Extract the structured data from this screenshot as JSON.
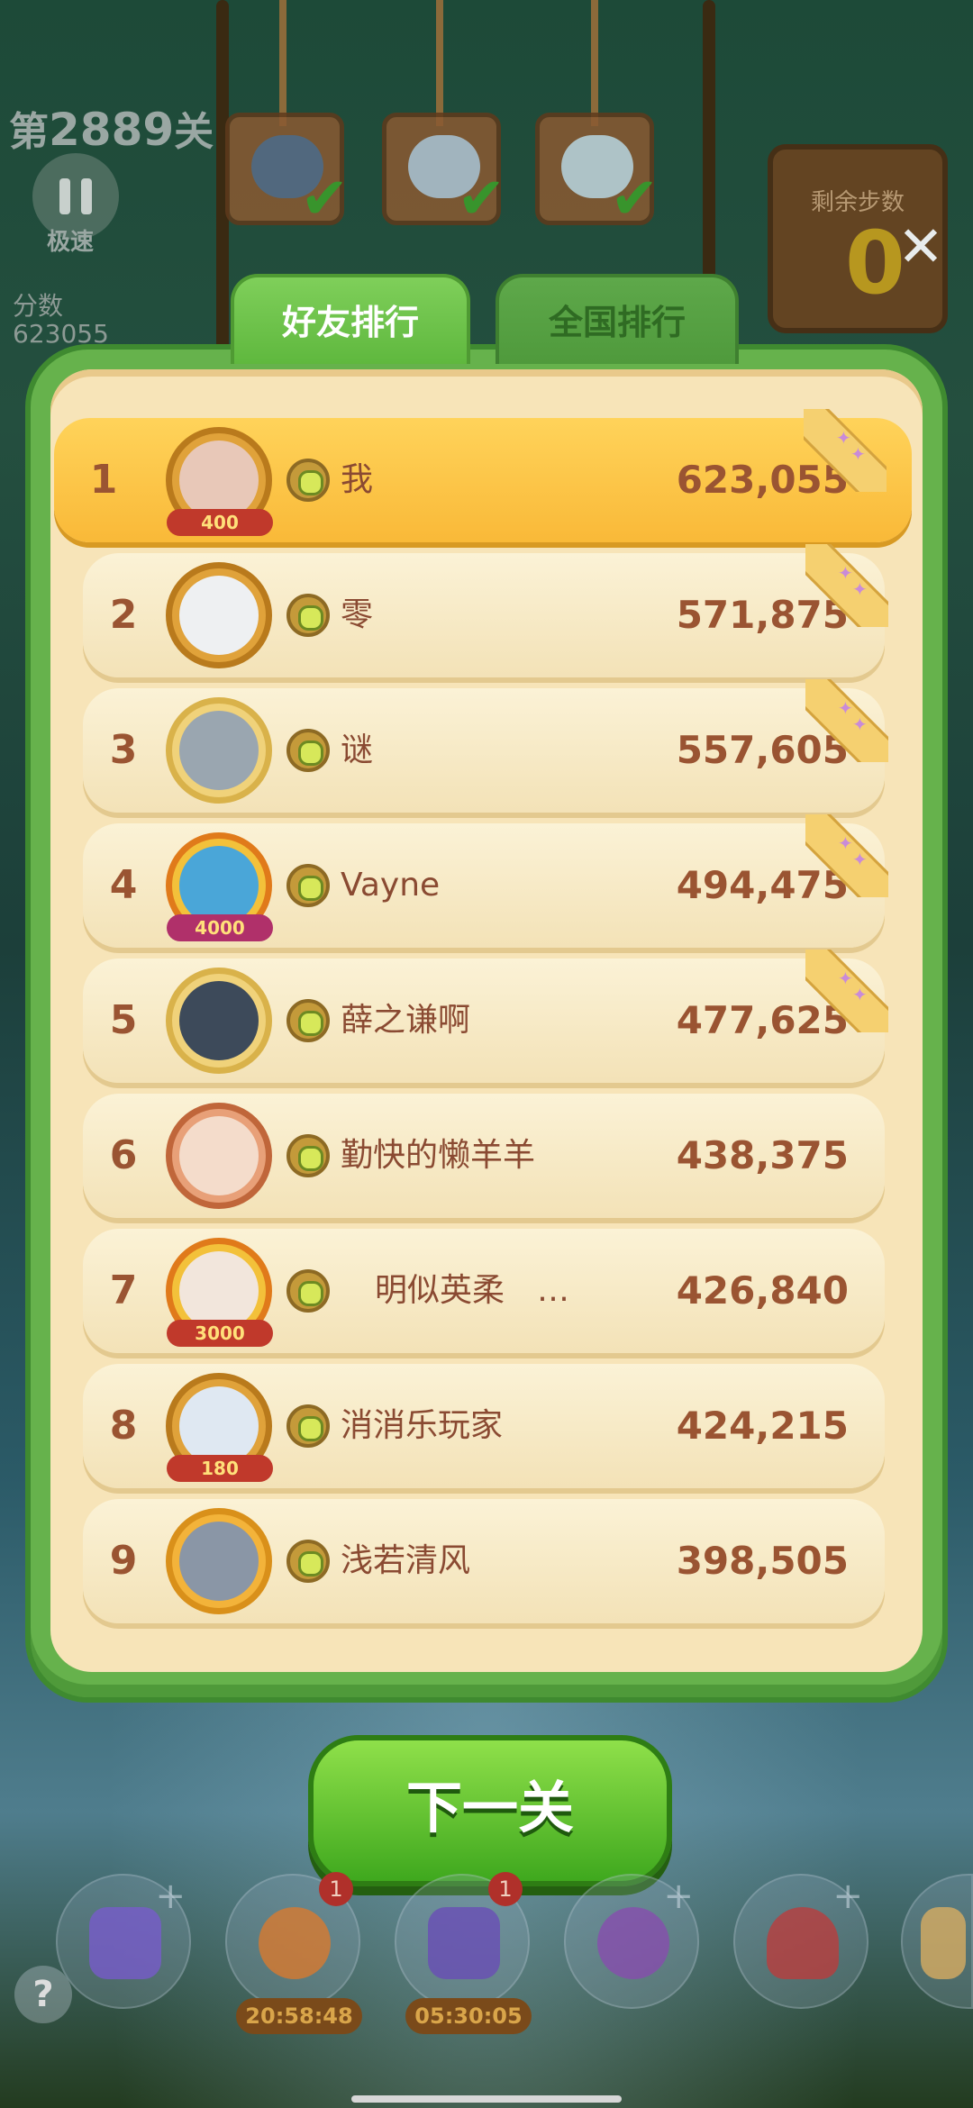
{
  "header": {
    "level_prefix": "第",
    "level_number": "2889",
    "level_suffix": "关",
    "speed_label": "极速",
    "score_label": "分数",
    "score_value": "623055",
    "moves_label": "剩余步数",
    "moves_value": "0"
  },
  "tabs": [
    {
      "label": "好友排行",
      "active": true
    },
    {
      "label": "全国排行",
      "active": false
    }
  ],
  "leaderboard": {
    "rows": [
      {
        "rank": "1",
        "name": "我",
        "score": "623,055",
        "badge": "400"
      },
      {
        "rank": "2",
        "name": "零",
        "score": "571,875",
        "badge": ""
      },
      {
        "rank": "3",
        "name": "谜",
        "score": "557,605",
        "badge": ""
      },
      {
        "rank": "4",
        "name": "Vayne",
        "score": "494,475",
        "badge": "4000"
      },
      {
        "rank": "5",
        "name": "薛之谦啊",
        "score": "477,625",
        "badge": ""
      },
      {
        "rank": "6",
        "name": "勤快的懒羊羊",
        "score": "438,375",
        "badge": ""
      },
      {
        "rank": "7",
        "name": "明似英柔　…",
        "score": "426,840",
        "badge": "3000"
      },
      {
        "rank": "8",
        "name": "消消乐玩家",
        "score": "424,215",
        "badge": "180"
      },
      {
        "rank": "9",
        "name": "浅若清风",
        "score": "398,505",
        "badge": ""
      }
    ]
  },
  "next_button": "下一关",
  "tools": [
    {
      "count": ""
    },
    {
      "count": "1",
      "timer": "20:58:48"
    },
    {
      "count": "1",
      "timer": "05:30:05"
    },
    {
      "count": ""
    },
    {
      "count": ""
    },
    {
      "count": ""
    }
  ],
  "help_label": "?",
  "close_label": "✕",
  "colors": {
    "panel_green": "#66b24c",
    "cream": "#f7e4b8",
    "gold_row": "#f9b938",
    "text_brown": "#9a5432",
    "button_green": "#3fa81e"
  }
}
